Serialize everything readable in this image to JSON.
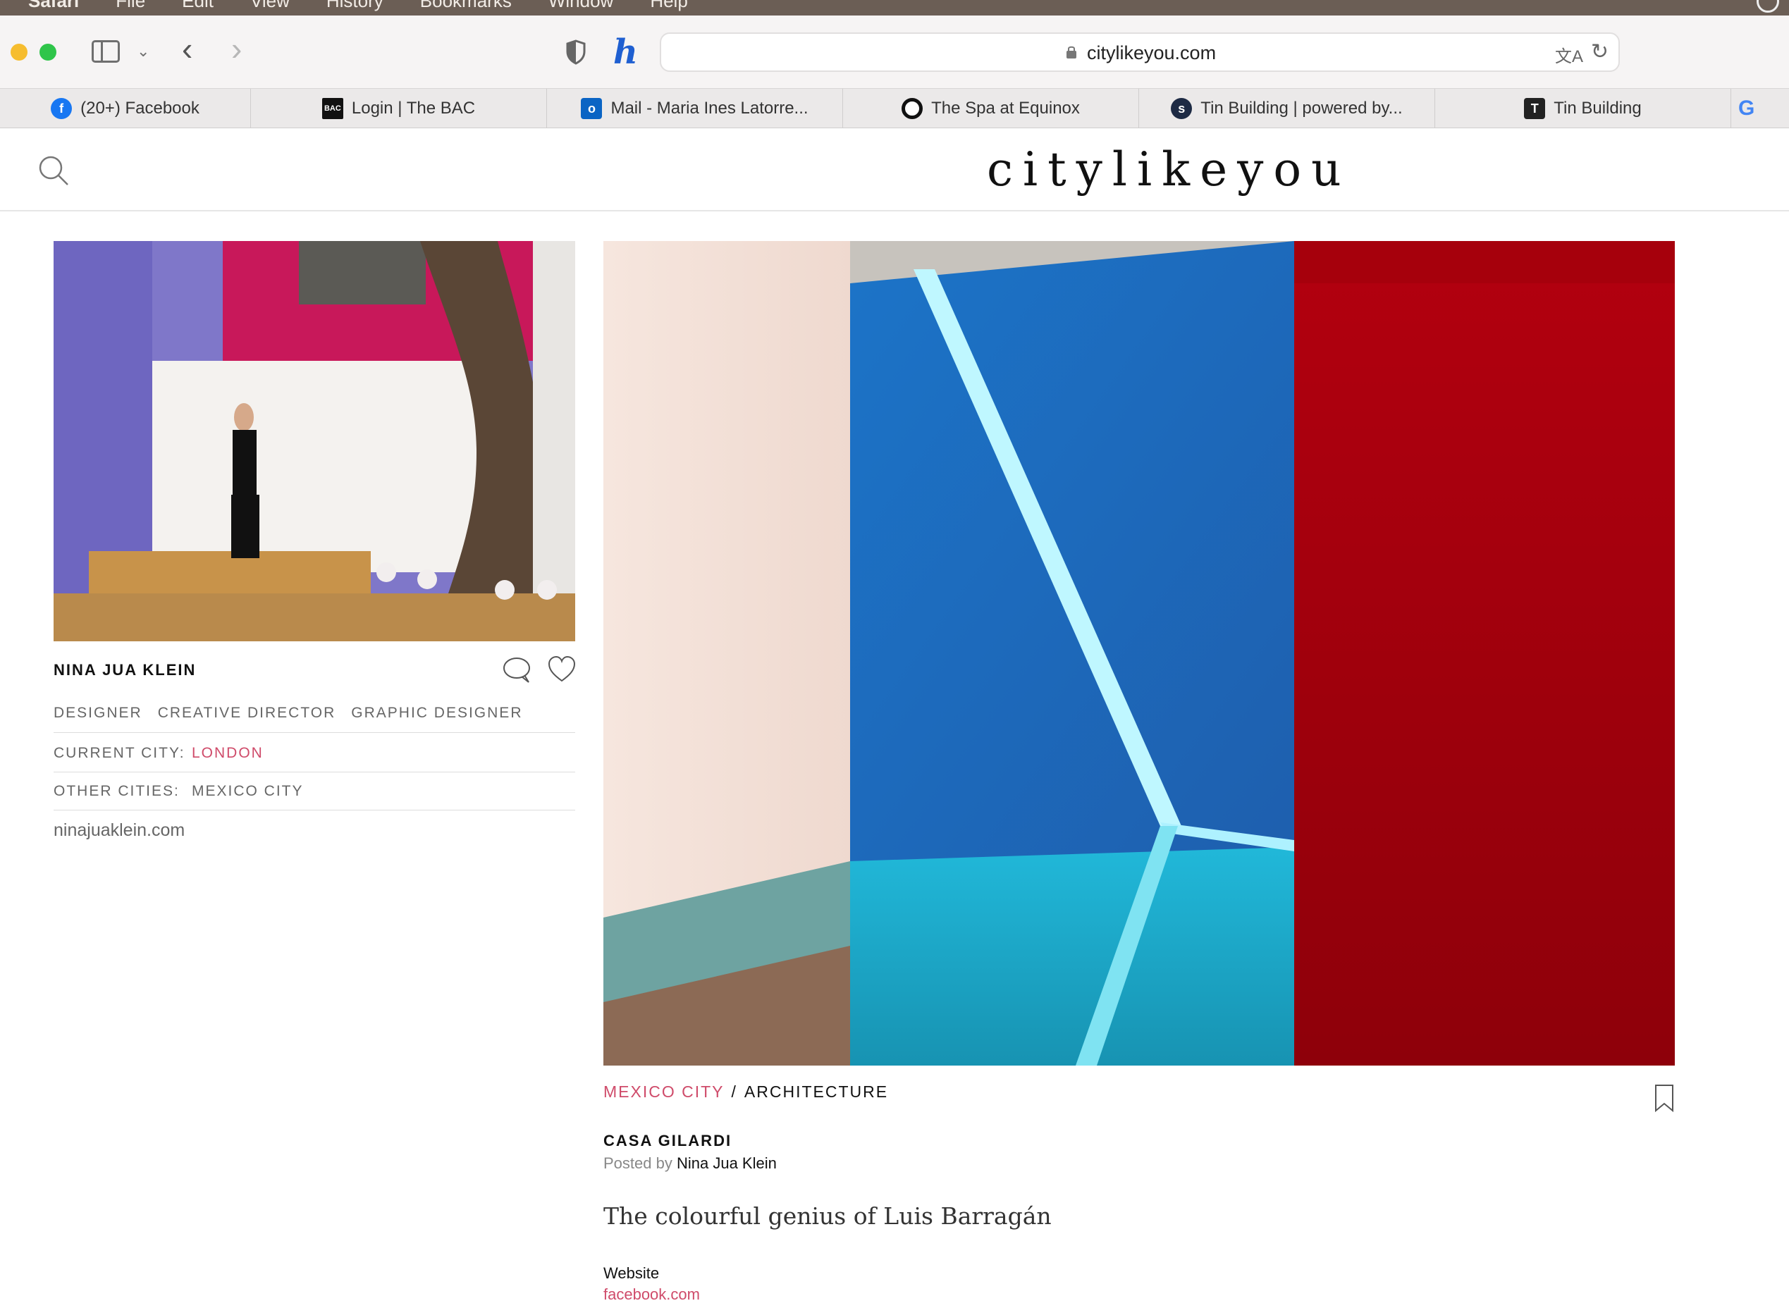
{
  "menubar": {
    "items": [
      "Safari",
      "File",
      "Edit",
      "View",
      "History",
      "Bookmarks",
      "Window",
      "Help"
    ]
  },
  "toolbar": {
    "url": "citylikeyou.com"
  },
  "tabs": [
    {
      "label": "(20+) Facebook",
      "icon": "facebook-icon"
    },
    {
      "label": "Login | The BAC",
      "icon": "bac-icon"
    },
    {
      "label": "Mail - Maria Ines Latorre...",
      "icon": "outlook-icon"
    },
    {
      "label": "The Spa at Equinox",
      "icon": "equinox-icon"
    },
    {
      "label": "Tin Building | powered by...",
      "icon": "tin-building-icon"
    },
    {
      "label": "Tin Building",
      "icon": "tin-building-seal-icon"
    },
    {
      "label": "",
      "icon": "google-icon"
    }
  ],
  "site": {
    "logo": "citylikeyou"
  },
  "profile": {
    "name": "NINA JUA KLEIN",
    "roles": [
      "DESIGNER",
      "CREATIVE DIRECTOR",
      "GRAPHIC DESIGNER"
    ],
    "current_city_label": "CURRENT CITY:",
    "current_city": "LONDON",
    "other_cities_label": "OTHER CITIES:",
    "other_cities": "MEXICO CITY",
    "website": "ninajuaklein.com"
  },
  "post": {
    "city": "MEXICO CITY",
    "separator": "/",
    "category": "ARCHITECTURE",
    "title": "CASA GILARDI",
    "posted_by_label": "Posted by",
    "author": "Nina Jua Klein",
    "subtitle": "The colourful genius of Luis Barragán",
    "website_label": "Website",
    "website_url": "facebook.com"
  },
  "colors": {
    "accent": "#cf4b6a",
    "text": "#111111",
    "muted": "#666666"
  }
}
